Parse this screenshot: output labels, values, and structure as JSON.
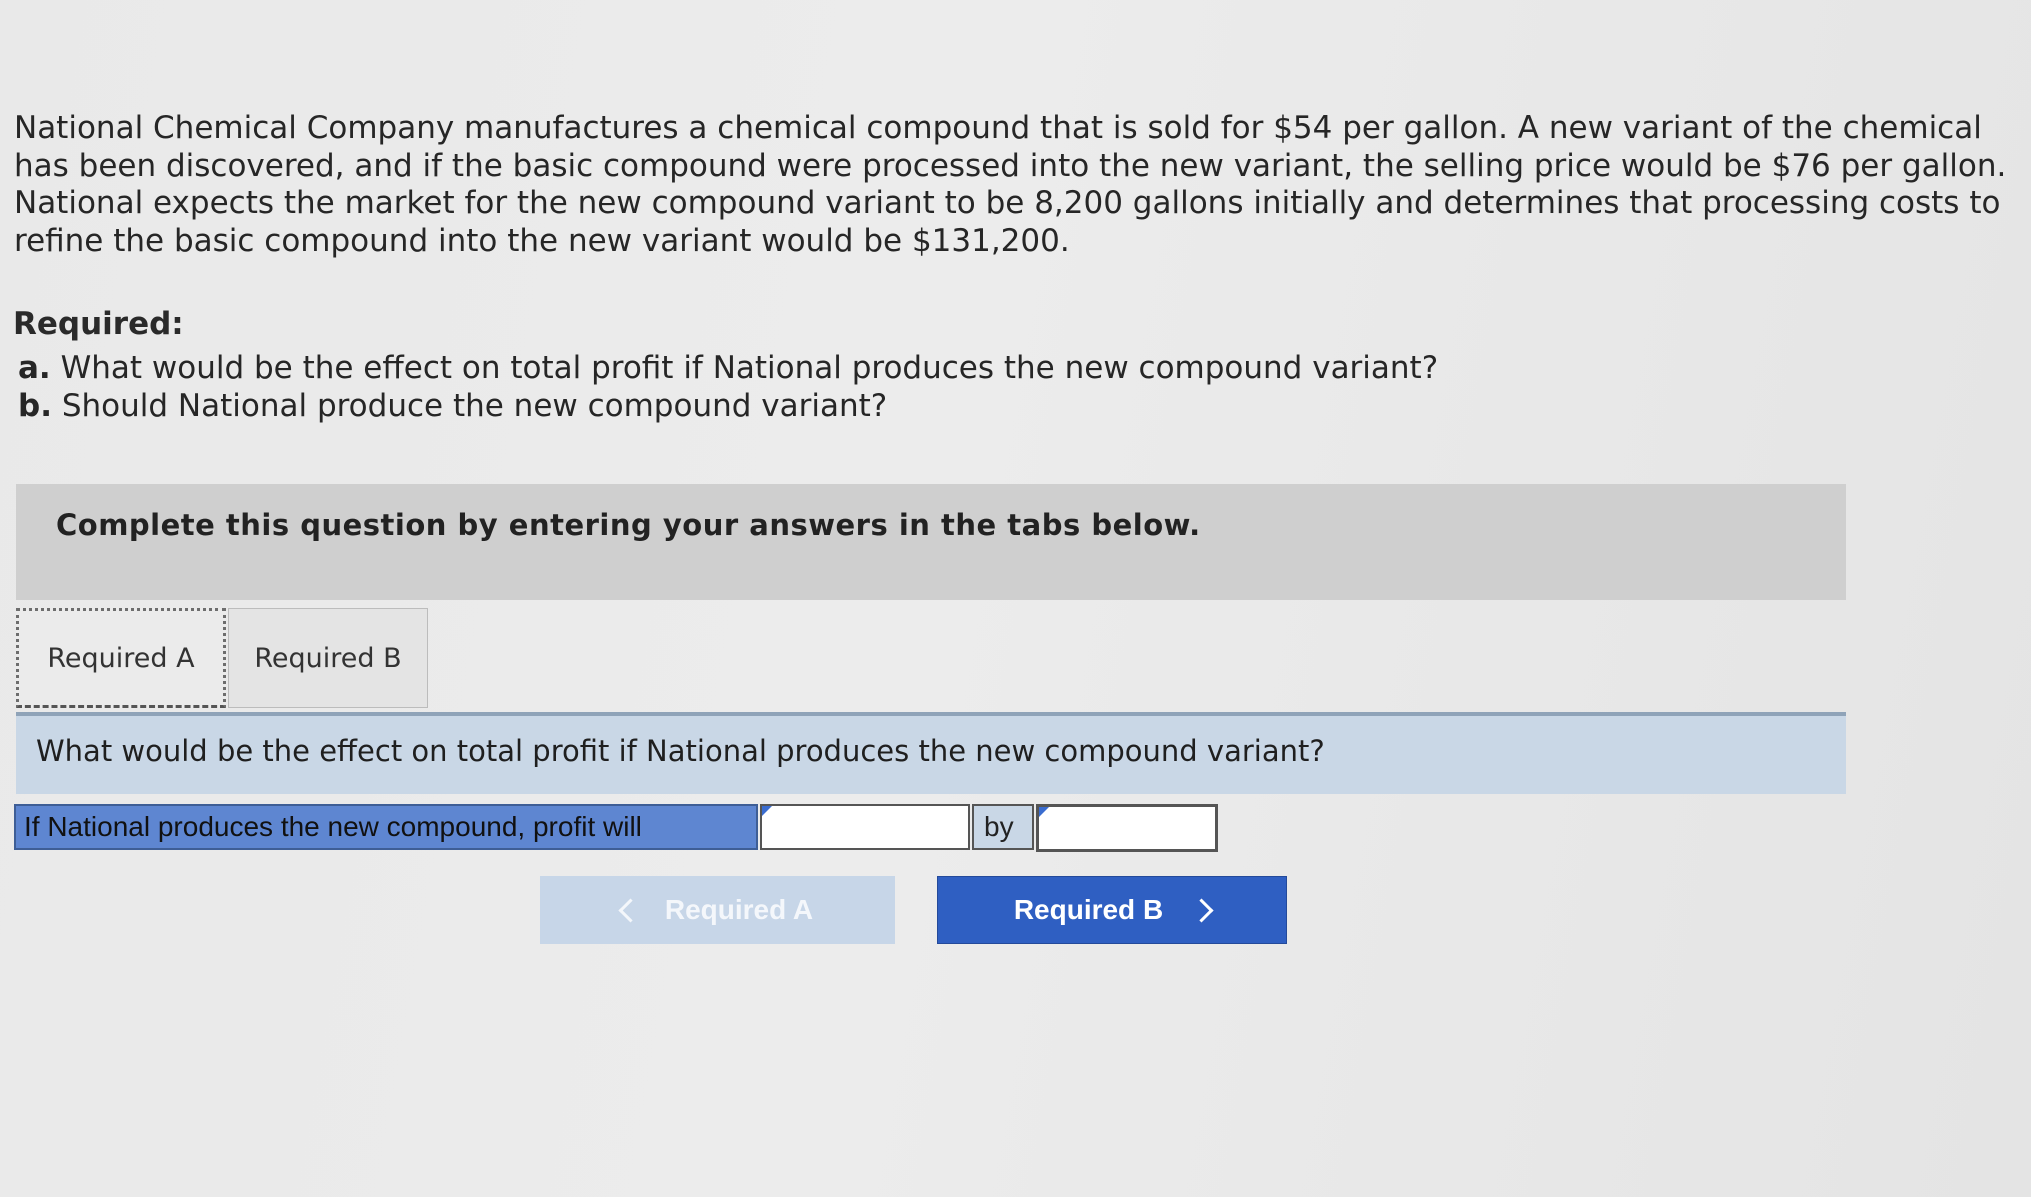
{
  "problem": {
    "text": "National Chemical Company manufactures a chemical compound that is sold for $54 per gallon. A new variant of the chemical has been discovered, and if the basic compound were processed into the new variant, the selling price would be $76 per gallon. National expects the market for the new compound variant to be 8,200 gallons initially and determines that processing costs to refine the basic compound into the new variant would be $131,200."
  },
  "required": {
    "heading": "Required:",
    "items": [
      {
        "label": "a.",
        "text": "What would be the effect on total profit if National produces the new compound variant?"
      },
      {
        "label": "b.",
        "text": "Should National produce the new compound variant?"
      }
    ]
  },
  "instruction": "Complete this question by entering your answers in the tabs below.",
  "tabs": [
    {
      "label": "Required A",
      "active": true
    },
    {
      "label": "Required B",
      "active": false
    }
  ],
  "panel": {
    "question": "What would be the effect on total profit if National produces the new compound variant?",
    "answer_row": {
      "label": "If National produces the new compound, profit will",
      "select_value": "",
      "by_label": "by",
      "amount_value": ""
    }
  },
  "nav": {
    "prev_label": "Required A",
    "next_label": "Required B"
  },
  "colors": {
    "instruction_bg": "#cfcfcf",
    "question_bar_bg": "#c9d7e6",
    "answer_label_bg": "#5e86d1",
    "next_button_bg": "#2f5fc2",
    "prev_button_bg": "#c7d6e8"
  }
}
